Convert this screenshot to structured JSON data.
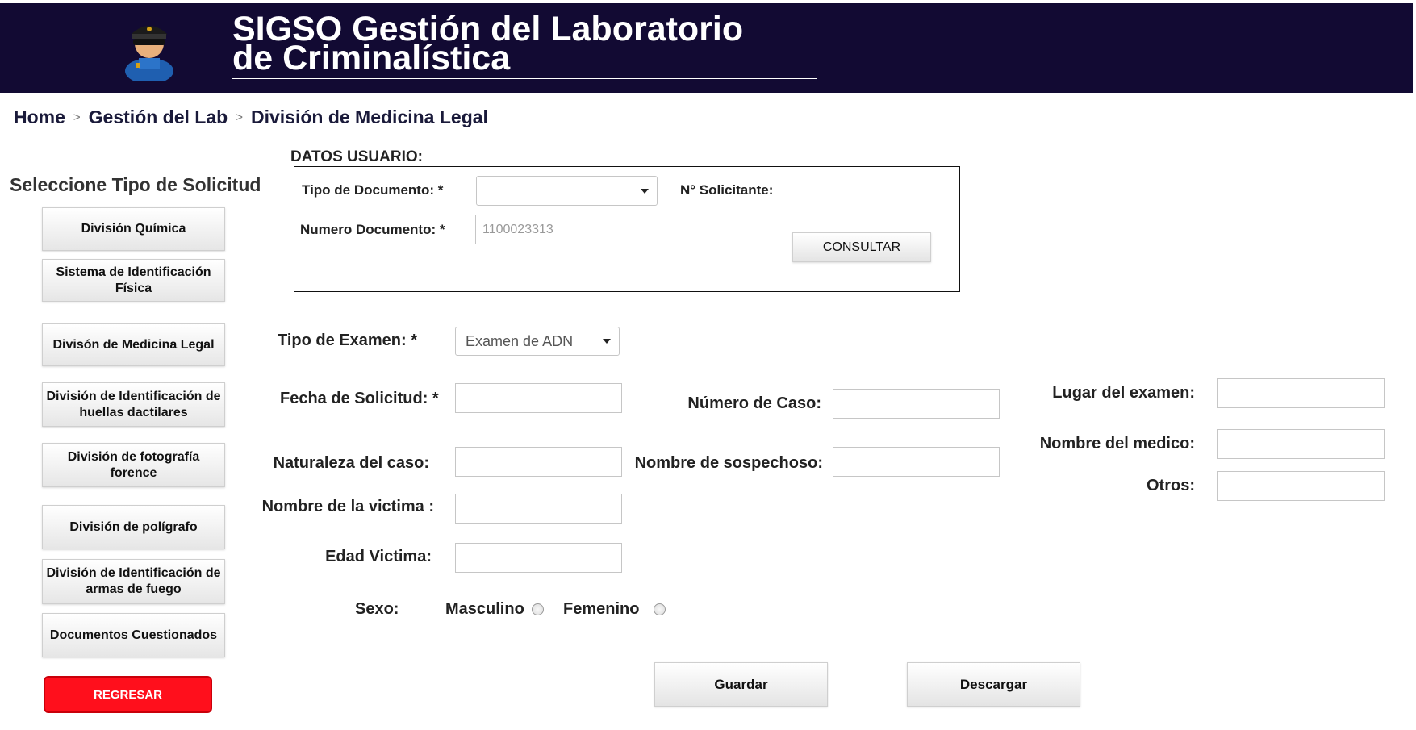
{
  "header": {
    "title_line1": "SIGSO  Gestión del Laboratorio",
    "title_line2": "de Criminalística",
    "logo_icon": "police-officer-icon"
  },
  "breadcrumb": {
    "items": [
      "Home",
      "Gestión del Lab",
      "División de Medicina Legal"
    ],
    "separator": ">"
  },
  "sidebar": {
    "title": "Seleccione Tipo de Solicitud",
    "buttons": [
      "División Química",
      "Sistema de Identificación Física",
      "Divisón de Medicina Legal",
      "División de Identificación de huellas dactilares",
      "División de fotografía forence",
      "División de polígrafo",
      "División de Identificación de armas de fuego",
      "Documentos Cuestionados"
    ],
    "back_label": "REGRESAR"
  },
  "datos_usuario": {
    "title": "DATOS USUARIO:",
    "tipo_documento_label": "Tipo de Documento: *",
    "tipo_documento_value": "",
    "numero_documento_label": "Numero Documento: *",
    "numero_documento_placeholder": "1100023313",
    "solicitante_label": "N° Solicitante:",
    "consultar_label": "CONSULTAR"
  },
  "form": {
    "tipo_examen_label": "Tipo de Examen: *",
    "tipo_examen_value": "Examen de ADN",
    "fecha_label": "Fecha de Solicitud: *",
    "numero_caso_label": "Número de Caso:",
    "lugar_label": "Lugar del examen:",
    "naturaleza_label": "Naturaleza del caso:",
    "sospechoso_label": "Nombre de sospechoso:",
    "medico_label": "Nombre del medico:",
    "otros_label": "Otros:",
    "victima_label": "Nombre de la victima :",
    "edad_label": "Edad Victima:",
    "sexo_label": "Sexo:",
    "sexo_options": [
      "Masculino",
      "Femenino"
    ]
  },
  "actions": {
    "guardar_label": "Guardar",
    "descargar_label": "Descargar"
  },
  "colors": {
    "header_bg": "#120a33",
    "back_button_bg": "#ff0f1c"
  }
}
